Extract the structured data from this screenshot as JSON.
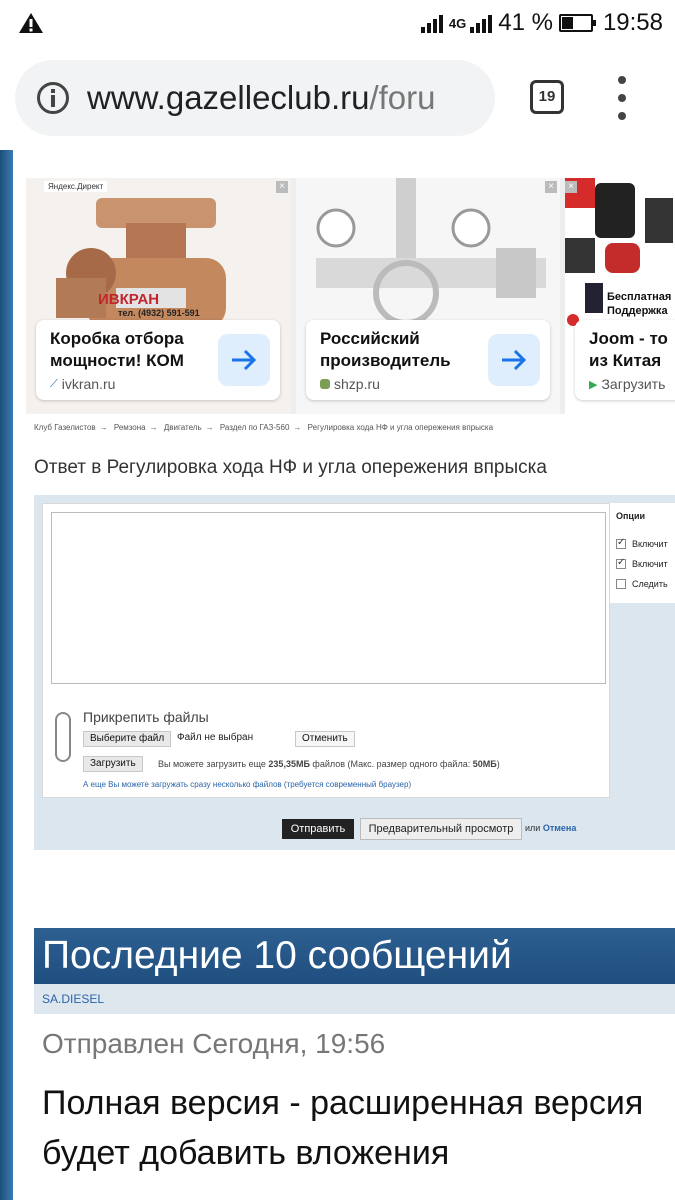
{
  "status_bar": {
    "warning_icon": "warning-icon",
    "network": "4G",
    "battery": "41 %",
    "battery_level": 0.41,
    "time": "19:58"
  },
  "browser": {
    "url_domain": "www.gazelleclub.ru",
    "url_path": "/foru",
    "tab_count": "19"
  },
  "ads": {
    "label": "Яндекс.Директ",
    "items": [
      {
        "title": "Коробка отбора мощности! КОМ",
        "domain": "ivkran.ru",
        "brand": "ИВКРАН",
        "phone": "тел. (4932) 591-591"
      },
      {
        "title": "Российский производитель",
        "domain": "shzp.ru"
      },
      {
        "title": "Joom - то из Китая",
        "domain": "Загрузить",
        "overlay": "Бесплатная Поддержка"
      }
    ]
  },
  "breadcrumb": [
    "Клуб Газелистов",
    "Ремзона",
    "Двигатель",
    "Раздел по ГАЗ-560",
    "Регулировка хода НФ и угла опережения впрыска"
  ],
  "reply_title": "Ответ в Регулировка хода НФ и угла опережения впрыска",
  "options": {
    "header": "Опции",
    "items": [
      {
        "label": "Включит",
        "checked": true
      },
      {
        "label": "Включит",
        "checked": true
      },
      {
        "label": "Следить",
        "checked": false
      }
    ]
  },
  "attach": {
    "label": "Прикрепить файлы",
    "choose_button": "Выберите файл",
    "no_file": "Файл не выбран",
    "cancel_button": "Отменить",
    "upload_button": "Загрузить",
    "quota_prefix": "Вы можете загрузить еще ",
    "quota_value": "235,35МБ",
    "quota_middle": " файлов (Макс. размер одного файла: ",
    "quota_max": "50МБ",
    "quota_suffix": ")",
    "multi_upload": "А еще Вы можете загружать сразу несколько файлов (требуется современный браузер)"
  },
  "submit": {
    "send": "Отправить",
    "preview": "Предварительный просмотр",
    "or": "или",
    "cancel": "Отмена"
  },
  "last_messages": {
    "heading": "Последние 10 сообщений",
    "author": "SA.DIESEL",
    "sent": "Отправлен Сегодня, 19:56",
    "text": "Полная версия - расширенная версия будет добавить вложения"
  }
}
